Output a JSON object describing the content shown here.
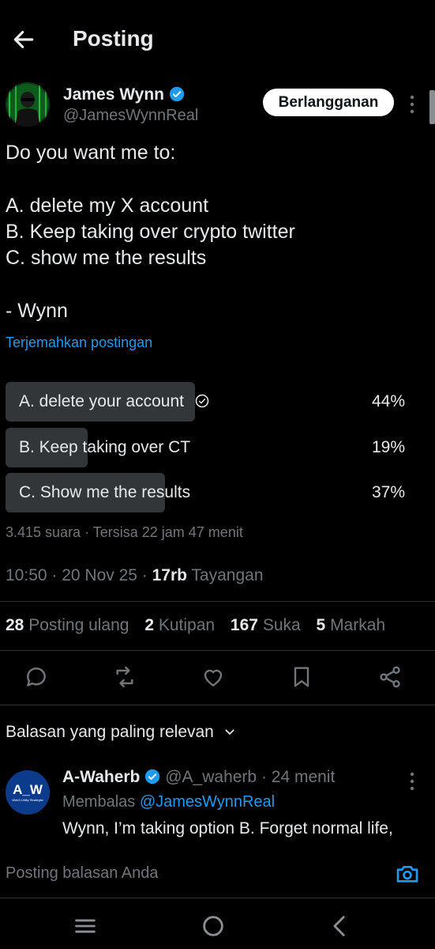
{
  "header": {
    "title": "Posting"
  },
  "author": {
    "name": "James Wynn",
    "handle": "@JamesWynnReal",
    "subscribe_label": "Berlangganan"
  },
  "tweet": {
    "lines": [
      "Do you want me to:",
      "A. delete my X account",
      "B. Keep taking over crypto twitter",
      "C. show me the results",
      "- Wynn"
    ],
    "translate_label": "Terjemahkan postingan"
  },
  "poll": {
    "options": [
      {
        "label": "A. delete your account",
        "percent_label": "44%",
        "percent": 44,
        "selected": true
      },
      {
        "label": "B. Keep taking over CT",
        "percent_label": "19%",
        "percent": 19,
        "selected": false
      },
      {
        "label": "C. Show me the results",
        "percent_label": "37%",
        "percent": 37,
        "selected": false
      }
    ],
    "meta": "3.415 suara · Tersisa 22 jam 47 menit"
  },
  "timestamp": {
    "time_date": "10:50 · 20 Nov 25 · ",
    "views_count": "17rb",
    "views_label": " Tayangan"
  },
  "stats": {
    "reposts_count": "28",
    "reposts_label": "Posting ulang",
    "quotes_count": "2",
    "quotes_label": "Kutipan",
    "likes_count": "167",
    "likes_label": "Suka",
    "bookmarks_count": "5",
    "bookmarks_label": "Markah"
  },
  "replies": {
    "sort_label": "Balasan yang paling relevan",
    "items": [
      {
        "avatar_text": "A_W",
        "avatar_subtext": "Web3 Utility Strategist",
        "name": "A-Waherb",
        "handle_time": " @A_waherb · 24 menit",
        "replying_prefix": "Membalas ",
        "replying_to": "@JamesWynnReal",
        "text": "Wynn, I’m taking option B. Forget normal life,"
      }
    ]
  },
  "compose": {
    "placeholder": "Posting balasan Anda"
  },
  "colors": {
    "background": "#000000",
    "accent": "#1d9bf0",
    "muted": "#71767b",
    "poll_bar": "#333639",
    "divider": "#2f3336"
  },
  "icons": {
    "back": "arrow-left-icon",
    "verified": "verified-badge-icon",
    "more": "more-vertical-icon",
    "reply": "reply-icon",
    "repost": "repost-icon",
    "like": "heart-icon",
    "bookmark": "bookmark-icon",
    "share": "share-icon",
    "camera": "camera-icon",
    "chevron": "chevron-down-icon"
  }
}
